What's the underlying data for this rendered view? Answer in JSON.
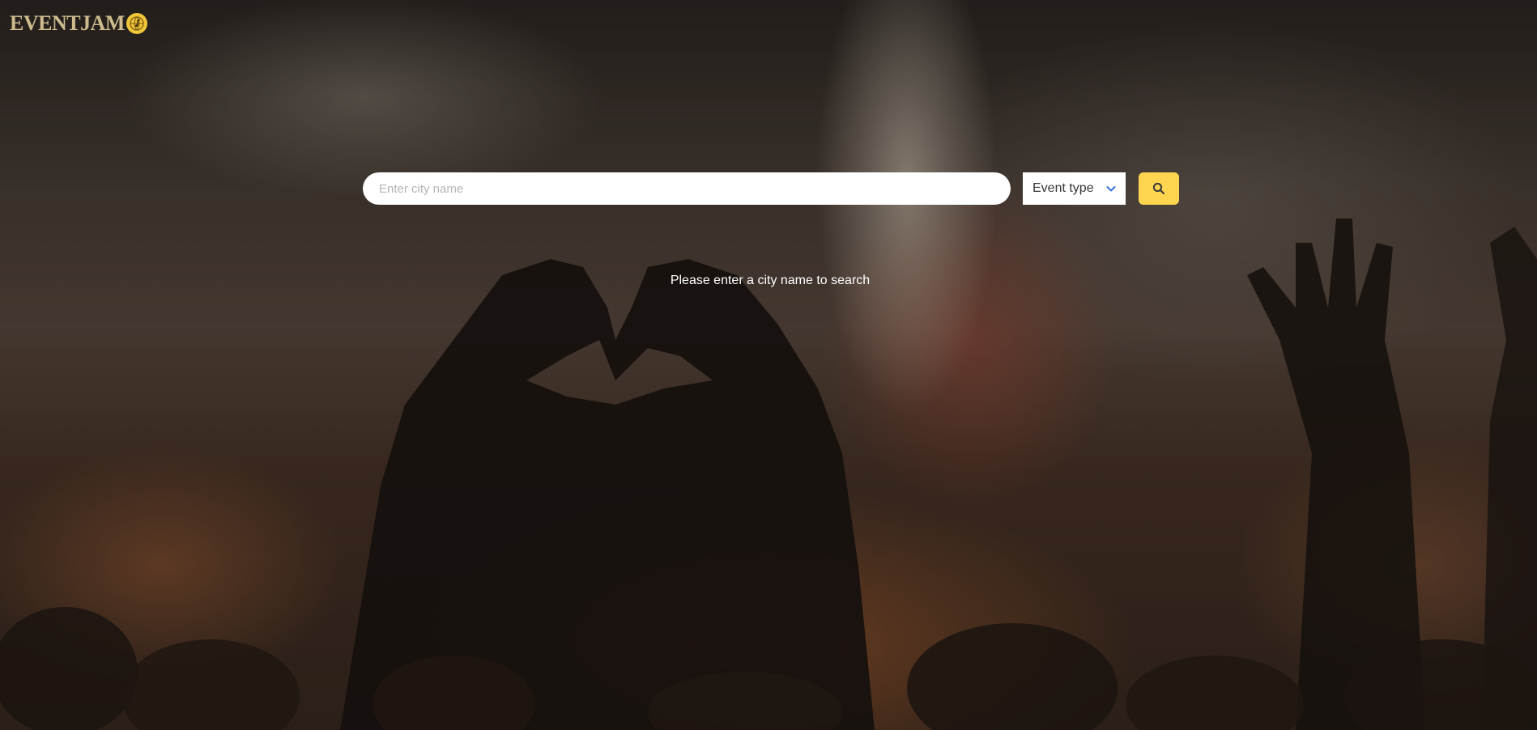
{
  "logo": {
    "text": "EVENTJAM",
    "icon": "globe-music-icon"
  },
  "search": {
    "placeholder": "Enter city name",
    "value": ""
  },
  "event_type": {
    "selected_label": "Event type",
    "icon": "chevron-down-icon"
  },
  "search_button": {
    "icon": "search-icon"
  },
  "status": {
    "message": "Please enter a city name to search"
  },
  "colors": {
    "accent": "#ffd54f",
    "chevron": "#3273dc",
    "logo_text": "#cdbb8e"
  }
}
